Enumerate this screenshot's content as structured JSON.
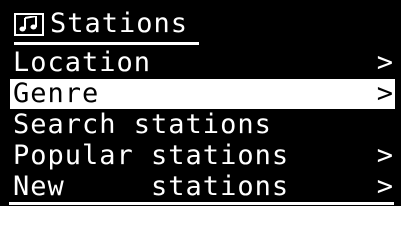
{
  "header": {
    "title": "Stations",
    "icon": "music-note-icon"
  },
  "menu": [
    {
      "label": "Location",
      "chevron": ">",
      "selected": false
    },
    {
      "label": "Genre",
      "chevron": ">",
      "selected": true
    },
    {
      "label": "Search stations",
      "chevron": "",
      "selected": false
    },
    {
      "label": "Popular stations",
      "chevron": ">",
      "selected": false
    },
    {
      "label": "New     stations",
      "chevron": ">",
      "selected": false
    }
  ],
  "colors": {
    "background": "#000000",
    "foreground": "#ffffff",
    "highlight": "#ffffff"
  }
}
